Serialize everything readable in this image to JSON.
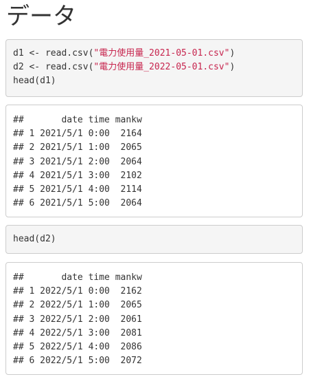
{
  "heading": "データ",
  "source1": {
    "line1": {
      "prefix": "d1 <- read.csv(",
      "string": "\"電力使用量_2021-05-01.csv\"",
      "suffix": ")"
    },
    "line2": {
      "prefix": "d2 <- read.csv(",
      "string": "\"電力使用量_2022-05-01.csv\"",
      "suffix": ")"
    },
    "line3": "head(d1)"
  },
  "output1": [
    "##       date time mankw",
    "## 1 2021/5/1 0:00  2164",
    "## 2 2021/5/1 1:00  2065",
    "## 3 2021/5/1 2:00  2064",
    "## 4 2021/5/1 3:00  2102",
    "## 5 2021/5/1 4:00  2114",
    "## 6 2021/5/1 5:00  2064"
  ],
  "source2": {
    "line1": "head(d2)"
  },
  "output2": [
    "##       date time mankw",
    "## 1 2022/5/1 0:00  2162",
    "## 2 2022/5/1 1:00  2065",
    "## 3 2022/5/1 2:00  2061",
    "## 4 2022/5/1 3:00  2081",
    "## 5 2022/5/1 4:00  2086",
    "## 6 2022/5/1 5:00  2072"
  ]
}
